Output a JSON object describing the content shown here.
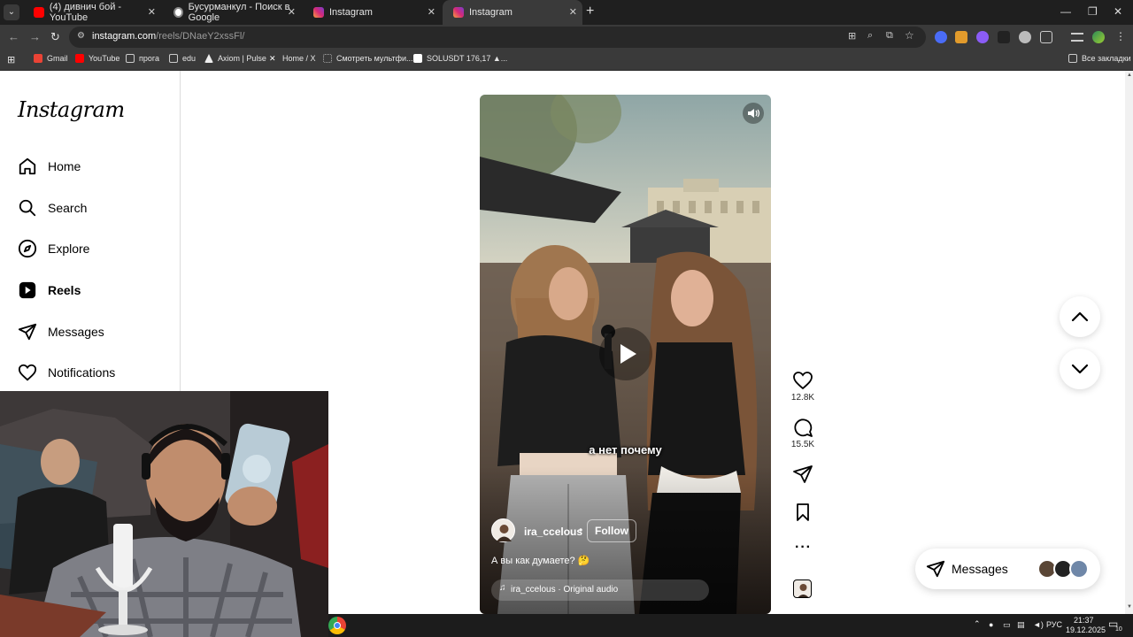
{
  "browser": {
    "tabs": [
      {
        "label": "(4) дивнич бой - YouTube",
        "active": false
      },
      {
        "label": "Бусурманкул - Поиск в Google",
        "active": false
      },
      {
        "label": "Instagram",
        "active": false
      },
      {
        "label": "Instagram",
        "active": true
      }
    ],
    "url_host": "instagram.com",
    "url_path": "/reels/DNaeY2xssFl/",
    "bookmarks": [
      "Gmail",
      "YouTube",
      "прога",
      "edu",
      "Axiom | Pulse",
      "Home / X",
      "Смотреть мультфи...",
      "SOLUSDT 176,17 ▲..."
    ],
    "all_bookmarks": "Все закладки"
  },
  "sidebar": {
    "logo": "Instagram",
    "items": [
      {
        "label": "Home",
        "icon": "home-icon"
      },
      {
        "label": "Search",
        "icon": "search-icon"
      },
      {
        "label": "Explore",
        "icon": "compass-icon"
      },
      {
        "label": "Reels",
        "icon": "reels-icon"
      },
      {
        "label": "Messages",
        "icon": "paper-plane-icon"
      },
      {
        "label": "Notifications",
        "icon": "heart-icon"
      }
    ]
  },
  "reel": {
    "caption_overlay": "а нет почему",
    "username": "ira_ccelous",
    "follow_label": "Follow",
    "description": "А вы как думаете? 🤔",
    "audio": "ira_ccelous · Original audio"
  },
  "actions": {
    "likes": "12.8K",
    "comments": "15.5K"
  },
  "messages_button": {
    "label": "Messages"
  },
  "taskbar": {
    "lang": "РУС",
    "time": "21:37",
    "date": "19.12.2025",
    "notifications": "10"
  },
  "colors": {
    "accent": "#0095f6",
    "chrome_dark": "#1f1f1f"
  }
}
